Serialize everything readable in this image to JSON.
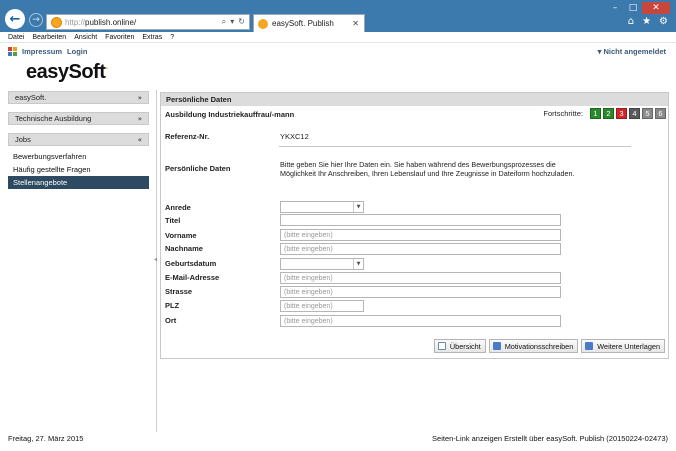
{
  "browser": {
    "url_proto": "http://",
    "url_host": "publish.online/",
    "tab_title": "easySoft. Publish",
    "menu": [
      "Datei",
      "Bearbeiten",
      "Ansicht",
      "Favoriten",
      "Extras",
      "?"
    ]
  },
  "header": {
    "impressum": "Impressum",
    "login": "Login",
    "status": "▾ Nicht angemeldet",
    "logo": "easySoft",
    "logo_dot": "."
  },
  "sidebar": {
    "sections": [
      {
        "label": "easySoft."
      },
      {
        "label": "Technische Ausbildung"
      },
      {
        "label": "Jobs"
      }
    ],
    "items": [
      {
        "label": "Bewerbungsverfahren"
      },
      {
        "label": "Häufig gestellte Fragen"
      },
      {
        "label": "Stellenangebote"
      }
    ]
  },
  "main": {
    "panel_title": "Persönliche Daten",
    "job_title": "Ausbildung Industriekauffrau/-mann",
    "progress_label": "Fortschritte:",
    "steps": [
      {
        "label": "1",
        "color": "#2a8a2a"
      },
      {
        "label": "2",
        "color": "#2a8a2a"
      },
      {
        "label": "3",
        "color": "#d02828"
      },
      {
        "label": "4",
        "color": "#5a5a5a"
      },
      {
        "label": "5",
        "color": "#8a8a8a"
      },
      {
        "label": "6",
        "color": "#8a8a8a"
      }
    ],
    "ref_label": "Referenz-Nr.",
    "ref_value": "YKXC12",
    "personal_label": "Persönliche Daten",
    "info_text": "Bitte geben Sie hier Ihre Daten ein. Sie haben während des Bewerbungsprozesses die Möglichkeit Ihr Anschreiben, Ihren Lebenslauf und Ihre Zeugnisse in Dateiform hochzuladen.",
    "fields": {
      "anrede": {
        "label": "Anrede",
        "value": ""
      },
      "titel": {
        "label": "Titel",
        "value": ""
      },
      "vorname": {
        "label": "Vorname",
        "placeholder": "(bitte eingeben)"
      },
      "nachname": {
        "label": "Nachname",
        "placeholder": "(bitte eingeben)"
      },
      "geburtsdatum": {
        "label": "Geburtsdatum",
        "value": ""
      },
      "email": {
        "label": "E-Mail-Adresse",
        "placeholder": "(bitte eingeben)"
      },
      "strasse": {
        "label": "Strasse",
        "placeholder": "(bitte eingeben)"
      },
      "plz": {
        "label": "PLZ",
        "placeholder": "(bitte eingeben)"
      },
      "ort": {
        "label": "Ort",
        "placeholder": "(bitte eingeben)"
      }
    },
    "buttons": {
      "overview": "Übersicht",
      "letter": "Motivationsschreiben",
      "more": "Weitere Unterlagen"
    }
  },
  "footer": {
    "date": "Freitag, 27. März 2015",
    "right": "Seiten-Link anzeigen Erstellt über easySoft. Publish (20150224-02473)"
  }
}
